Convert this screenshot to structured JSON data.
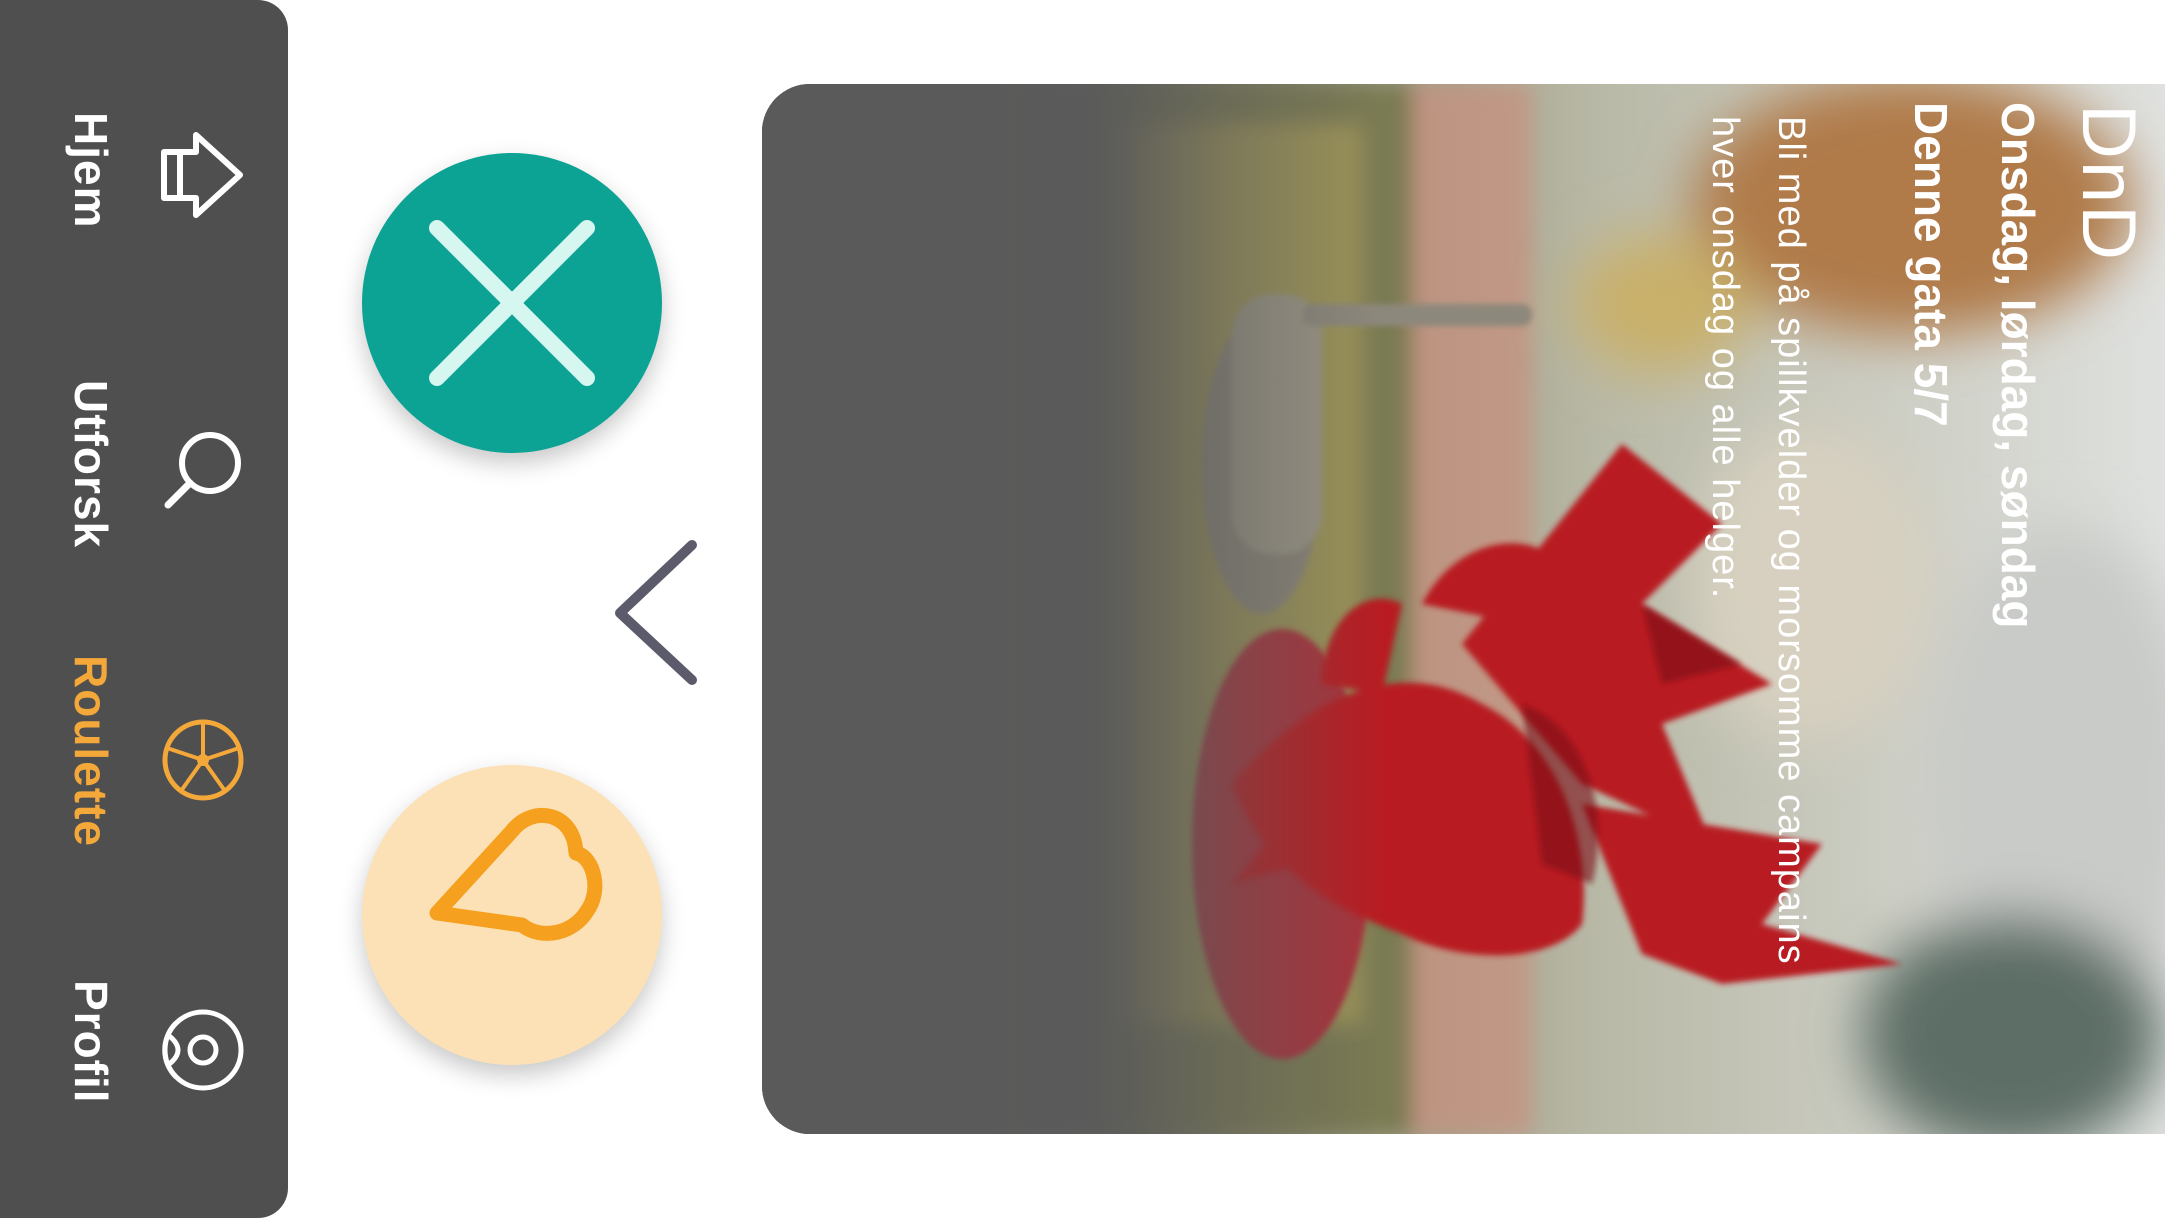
{
  "colors": {
    "nav_bg": "#4f4f4f",
    "nav_text": "#ffffff",
    "nav_active": "#f5a83a",
    "dislike_bg": "#0ca294",
    "dislike_icon": "#d6f7ef",
    "like_bg": "#fde1b6",
    "like_icon": "#f5a11f",
    "chevron": "#5b5b6b"
  },
  "nav": {
    "items": [
      {
        "label": "Hjem",
        "icon": "home-arrow-icon",
        "active": false
      },
      {
        "label": "Utforsk",
        "icon": "search-icon",
        "active": false
      },
      {
        "label": "Roulette",
        "icon": "roulette-wheel-icon",
        "active": true
      },
      {
        "label": "Profil",
        "icon": "profile-icon",
        "active": false
      }
    ]
  },
  "actions": {
    "dislike_icon": "close-x-icon",
    "like_icon": "heart-icon",
    "back_icon": "chevron-left-icon"
  },
  "card": {
    "image": "red-dragon-miniature-on-game-board",
    "title": "DnD",
    "days": "Onsdag, lørdag, søndag",
    "address": "Denne gata 5/7",
    "description_line1": "Bli med på spillkvelder og morsomme campains",
    "description_line2": "hver onsdag og alle helger."
  }
}
